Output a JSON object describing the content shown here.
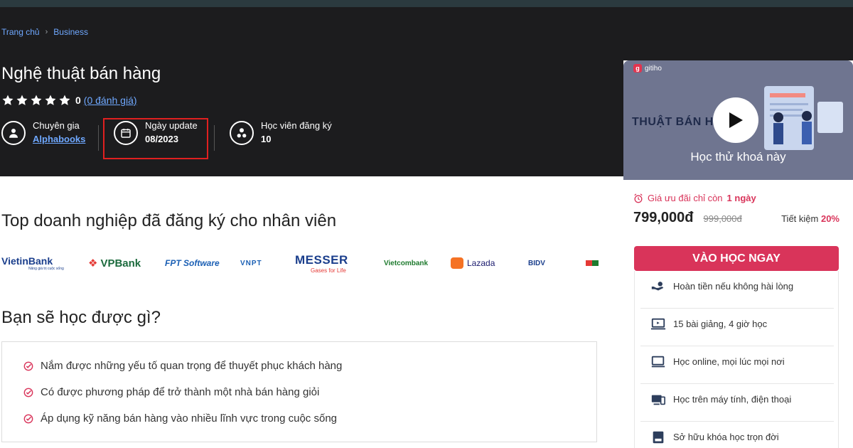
{
  "breadcrumb": {
    "home": "Trang chủ",
    "sep": "›",
    "category": "Business"
  },
  "course": {
    "title": "Nghệ thuật bán hàng",
    "rating_count": "0",
    "rating_link": "(0 đánh giá)",
    "stars": 5
  },
  "meta": {
    "expert_label": "Chuyên gia",
    "expert_value": "Alphabooks",
    "update_label": "Ngày update",
    "update_value": "08/2023",
    "students_label": "Học viên đăng ký",
    "students_value": "10"
  },
  "companies": {
    "heading": "Top doanh nghiệp đã đăng ký cho nhân viên",
    "logos": [
      "VietinBank",
      "VPBank",
      "FPT Software",
      "VNPT",
      "MESSER",
      "Vietcombank",
      "Lazada",
      "BIDV"
    ],
    "vietin_tagline": "Nâng giá trị cuộc sống",
    "messer_tagline": "Gases for Life"
  },
  "learn": {
    "heading": "Bạn sẽ học được gì?",
    "items": [
      "Nắm được những yếu tố quan trọng để thuyết phục khách hàng",
      "Có được phương pháp để trở thành một nhà bán hàng giỏi",
      "Áp dụng kỹ năng bán hàng vào nhiều lĩnh vực trong cuộc sống"
    ]
  },
  "sidebar": {
    "brand": "gitiho",
    "thumb_text": "THUẬT BÁN H",
    "try_label": "Học thử khoá này",
    "offer_prefix": "Giá ưu đãi chỉ còn",
    "offer_time": "1 ngày",
    "price": "799,000đ",
    "old_price": "999,000đ",
    "save_prefix": "Tiết kiệm",
    "save_pct": "20%",
    "cta": "VÀO HỌC NGAY",
    "features": [
      "Hoàn tiền nếu không hài lòng",
      "15 bài giảng, 4 giờ học",
      "Học online, mọi lúc mọi nơi",
      "Học trên máy tính, điện thoại",
      "Sở hữu khóa học trọn đời"
    ]
  },
  "colors": {
    "accent": "#d9345a",
    "link": "#6fa8ff",
    "hero_bg": "#1c1c1e"
  }
}
